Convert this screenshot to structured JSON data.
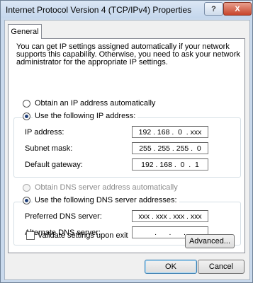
{
  "window": {
    "title": "Internet Protocol Version 4 (TCP/IPv4) Properties",
    "help_glyph": "?",
    "close_glyph": "X"
  },
  "tabs": [
    {
      "label": "General"
    }
  ],
  "description": "You can get IP settings assigned automatically if your network supports this capability. Otherwise, you need to ask your network administrator for the appropriate IP settings.",
  "ip": {
    "auto_label": "Obtain an IP address automatically",
    "manual_label": "Use the following IP address:",
    "selected": "manual",
    "fields": [
      {
        "label": "IP address:",
        "value": "192 . 168 .  0  . xxx"
      },
      {
        "label": "Subnet mask:",
        "value": "255 . 255 . 255 .  0"
      },
      {
        "label": "Default gateway:",
        "value": "192 . 168 .  0  .  1"
      }
    ]
  },
  "dns": {
    "auto_label": "Obtain DNS server address automatically",
    "auto_disabled": true,
    "manual_label": "Use the following DNS server addresses:",
    "selected": "manual",
    "fields": [
      {
        "label": "Preferred DNS server:",
        "value": "xxx . xxx . xxx . xxx"
      },
      {
        "label": "Alternate DNS server:",
        "value": "     .      .      .     "
      }
    ]
  },
  "validate": {
    "label": "Validate settings upon exit",
    "checked": false
  },
  "buttons": {
    "advanced": "Advanced...",
    "ok": "OK",
    "cancel": "Cancel"
  }
}
